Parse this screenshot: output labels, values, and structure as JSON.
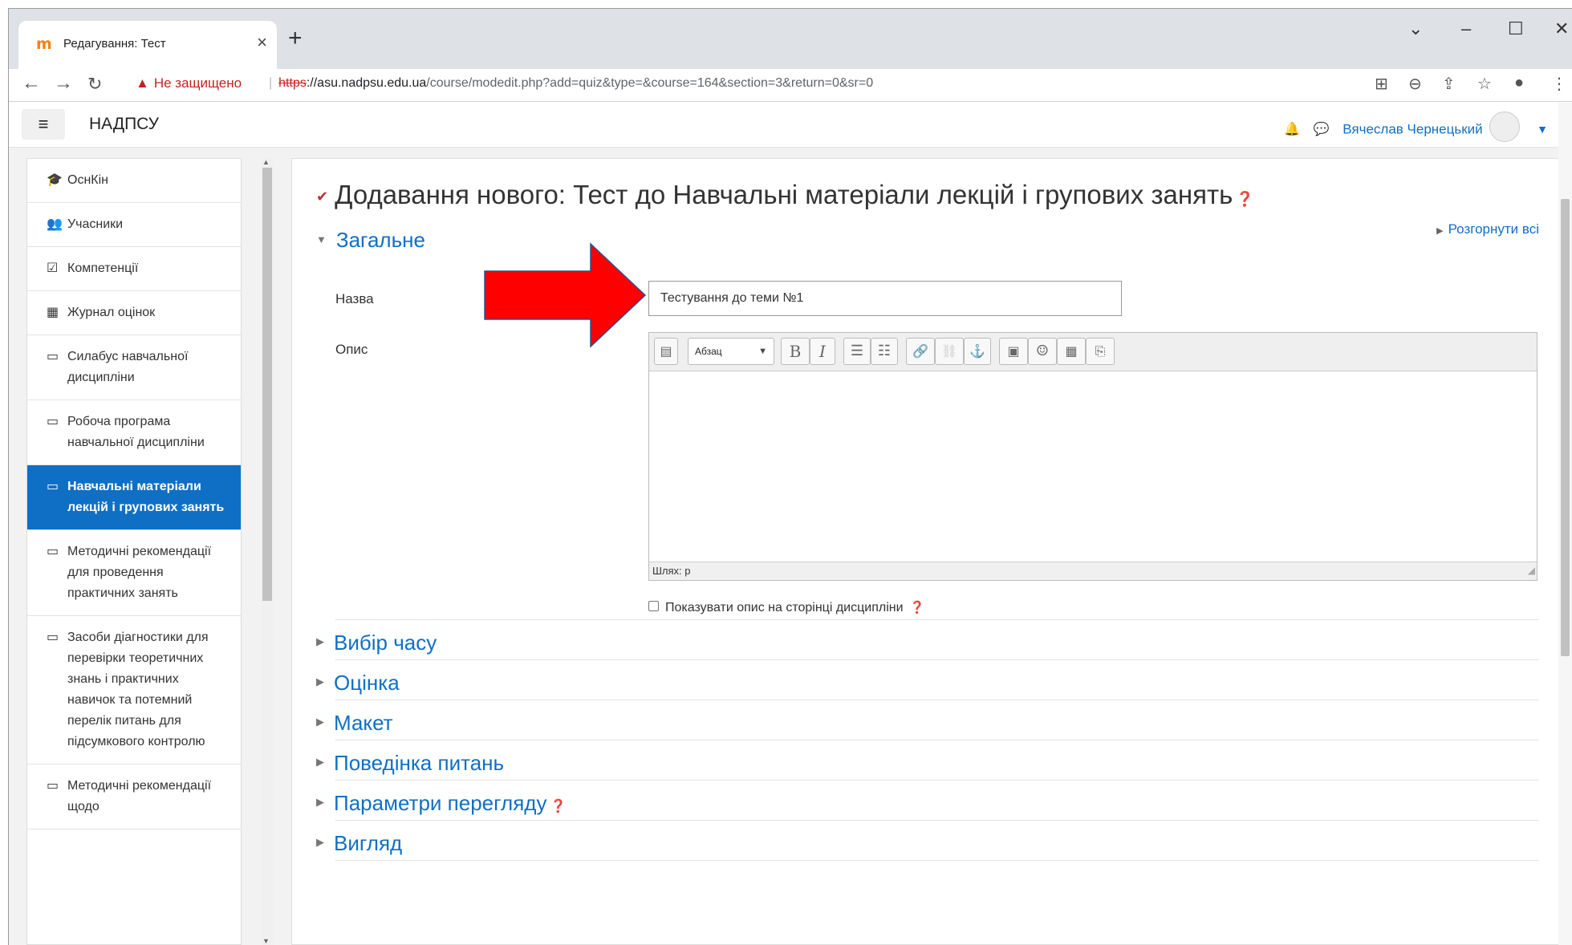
{
  "browser": {
    "tab_title": "Редагування: Тест",
    "tab_favicon": "moodle-icon",
    "security_label": "Не защищено",
    "url_scheme": "https",
    "url_host": "://asu.nadpsu.edu.ua",
    "url_path": "/course/modedit.php?add=quiz&type=&course=164&section=3&return=0&sr=0"
  },
  "navbar": {
    "brand": "НАДПСУ",
    "user_name": "Вячеслав Чернецький"
  },
  "sidebar": {
    "items": [
      {
        "icon": "graduation-cap-icon",
        "glyph": "🎓",
        "label": "ОснКін",
        "active": false
      },
      {
        "icon": "users-icon",
        "glyph": "👥",
        "label": "Учасники",
        "active": false
      },
      {
        "icon": "checkbox-icon",
        "glyph": "☑",
        "label": "Компетенції",
        "active": false
      },
      {
        "icon": "table-icon",
        "glyph": "▦",
        "label": "Журнал оцінок",
        "active": false
      },
      {
        "icon": "folder-icon",
        "glyph": "▭",
        "label": "Силабус навчальної дисципліни",
        "active": false
      },
      {
        "icon": "folder-icon",
        "glyph": "▭",
        "label": "Робоча програма навчальної дисципліни",
        "active": false
      },
      {
        "icon": "folder-icon",
        "glyph": "▭",
        "label": "Навчальні матеріали лекцій і групових занять",
        "active": true
      },
      {
        "icon": "folder-icon",
        "glyph": "▭",
        "label": "Методичні рекомендації для проведення практичних занять",
        "active": false
      },
      {
        "icon": "folder-icon",
        "glyph": "▭",
        "label": "Засоби діагностики для перевірки теоретичних знань і практичних навичок та потемний перелік питань для підсумкового контролю",
        "active": false
      },
      {
        "icon": "folder-icon",
        "glyph": "▭",
        "label": "Методичні рекомендації щодо",
        "active": false
      }
    ]
  },
  "main": {
    "heading": "Додавання нового: Тест до Навчальні матеріали лекцій і групових занять",
    "expand_all": "Розгорнути всі",
    "section_general": "Загальне",
    "name_label": "Назва",
    "name_value": "Тестування до теми №1",
    "description_label": "Опис",
    "editor_format": "Абзац",
    "editor_path": "Шлях: p",
    "show_description": "Показувати опис на сторінці дисципліни",
    "sections": [
      {
        "label": "Вибір часу",
        "help": false
      },
      {
        "label": "Оцінка",
        "help": false
      },
      {
        "label": "Макет",
        "help": false
      },
      {
        "label": "Поведінка питань",
        "help": false
      },
      {
        "label": "Параметри перегляду",
        "help": true
      },
      {
        "label": "Вигляд",
        "help": false
      }
    ]
  },
  "annotation": {
    "arrow_color": "#ff0000",
    "arrow_target": "name-input"
  },
  "colors": {
    "accent": "#0f6fc5",
    "active_bg": "#0f6fc5",
    "warning": "#c5221f"
  }
}
